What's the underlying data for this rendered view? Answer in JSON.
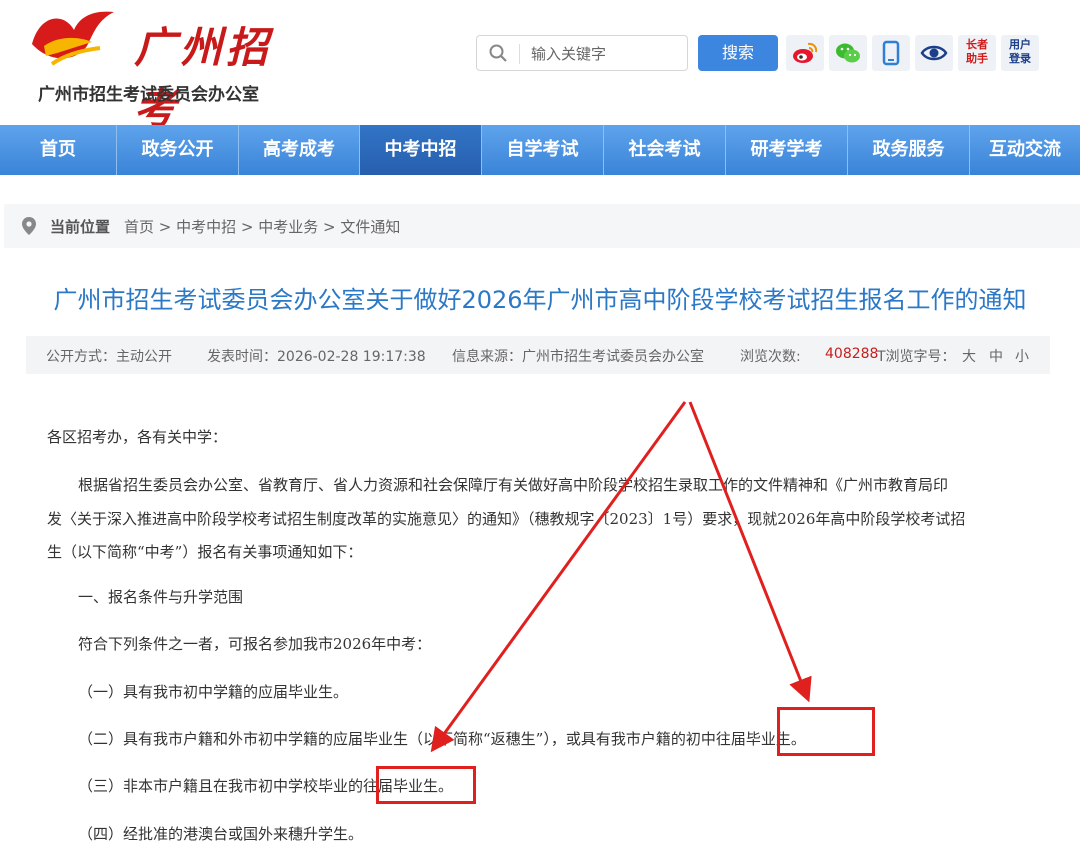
{
  "header": {
    "logo_text": "广州招考",
    "logo_subtitle": "广州市招生考试委员会办公室",
    "search_placeholder": "输入关键字",
    "search_button": "搜索",
    "tools": {
      "weibo_icon": "weibo-icon",
      "wechat_icon": "wechat-icon",
      "mobile_icon": "mobile-icon",
      "eye_icon": "eye-icon",
      "elder_label_1": "长者",
      "elder_label_2": "助手",
      "login_label_1": "用户",
      "login_label_2": "登录"
    }
  },
  "nav": {
    "items": [
      {
        "label": "首页"
      },
      {
        "label": "政务公开"
      },
      {
        "label": "高考成考"
      },
      {
        "label": "中考中招"
      },
      {
        "label": "自学考试"
      },
      {
        "label": "社会考试"
      },
      {
        "label": "研考学考"
      },
      {
        "label": "政务服务"
      },
      {
        "label": "互动交流"
      }
    ],
    "active_index": 3
  },
  "breadcrumb": {
    "label": "当前位置",
    "path": "首页 > 中考中招 > 中考业务 > 文件通知"
  },
  "article": {
    "title": "广州市招生考试委员会办公室关于做好2026年广州市高中阶段学校考试招生报名工作的通知",
    "meta": {
      "publish_mode": "公开方式：主动公开",
      "publish_time": "发表时间：2026-02-28 19:17:38",
      "source": "信息来源：广州市招生考试委员会办公室",
      "views_label": "浏览次数:",
      "views_count": "408288",
      "font_size_label": "T浏览字号：",
      "font_large": "大",
      "font_medium": "中",
      "font_small": "小"
    },
    "salutation": "各区招考办，各有关中学：",
    "para1_line1": "根据省招生委员会办公室、省教育厅、省人力资源和社会保障厅有关做好高中阶段学校招生录取工作的文件精神和《广州市教育局印",
    "para1_line2": "发〈关于深入推进高中阶段学校考试招生制度改革的实施意见〉的通知》（穗教规字〔2023〕1号）要求，现就2026年高中阶段学校考试招",
    "para1_line3": "生（以下简称“中考”）报名有关事项通知如下：",
    "section1": "一、报名条件与升学范围",
    "intro": "符合下列条件之一者，可报名参加我市2026年中考：",
    "item1": "（一）具有我市初中学籍的应届毕业生。",
    "item2": "（二）具有我市户籍和外市初中学籍的应届毕业生（以下简称“返穗生”），或具有我市户籍的初中往届毕业生。",
    "item3": "（三）非本市户籍且在我市初中学校毕业的往届毕业生。",
    "item4": "（四）经批准的港澳台或国外来穗升学生。"
  },
  "annotation": {
    "color": "#e0201f"
  }
}
